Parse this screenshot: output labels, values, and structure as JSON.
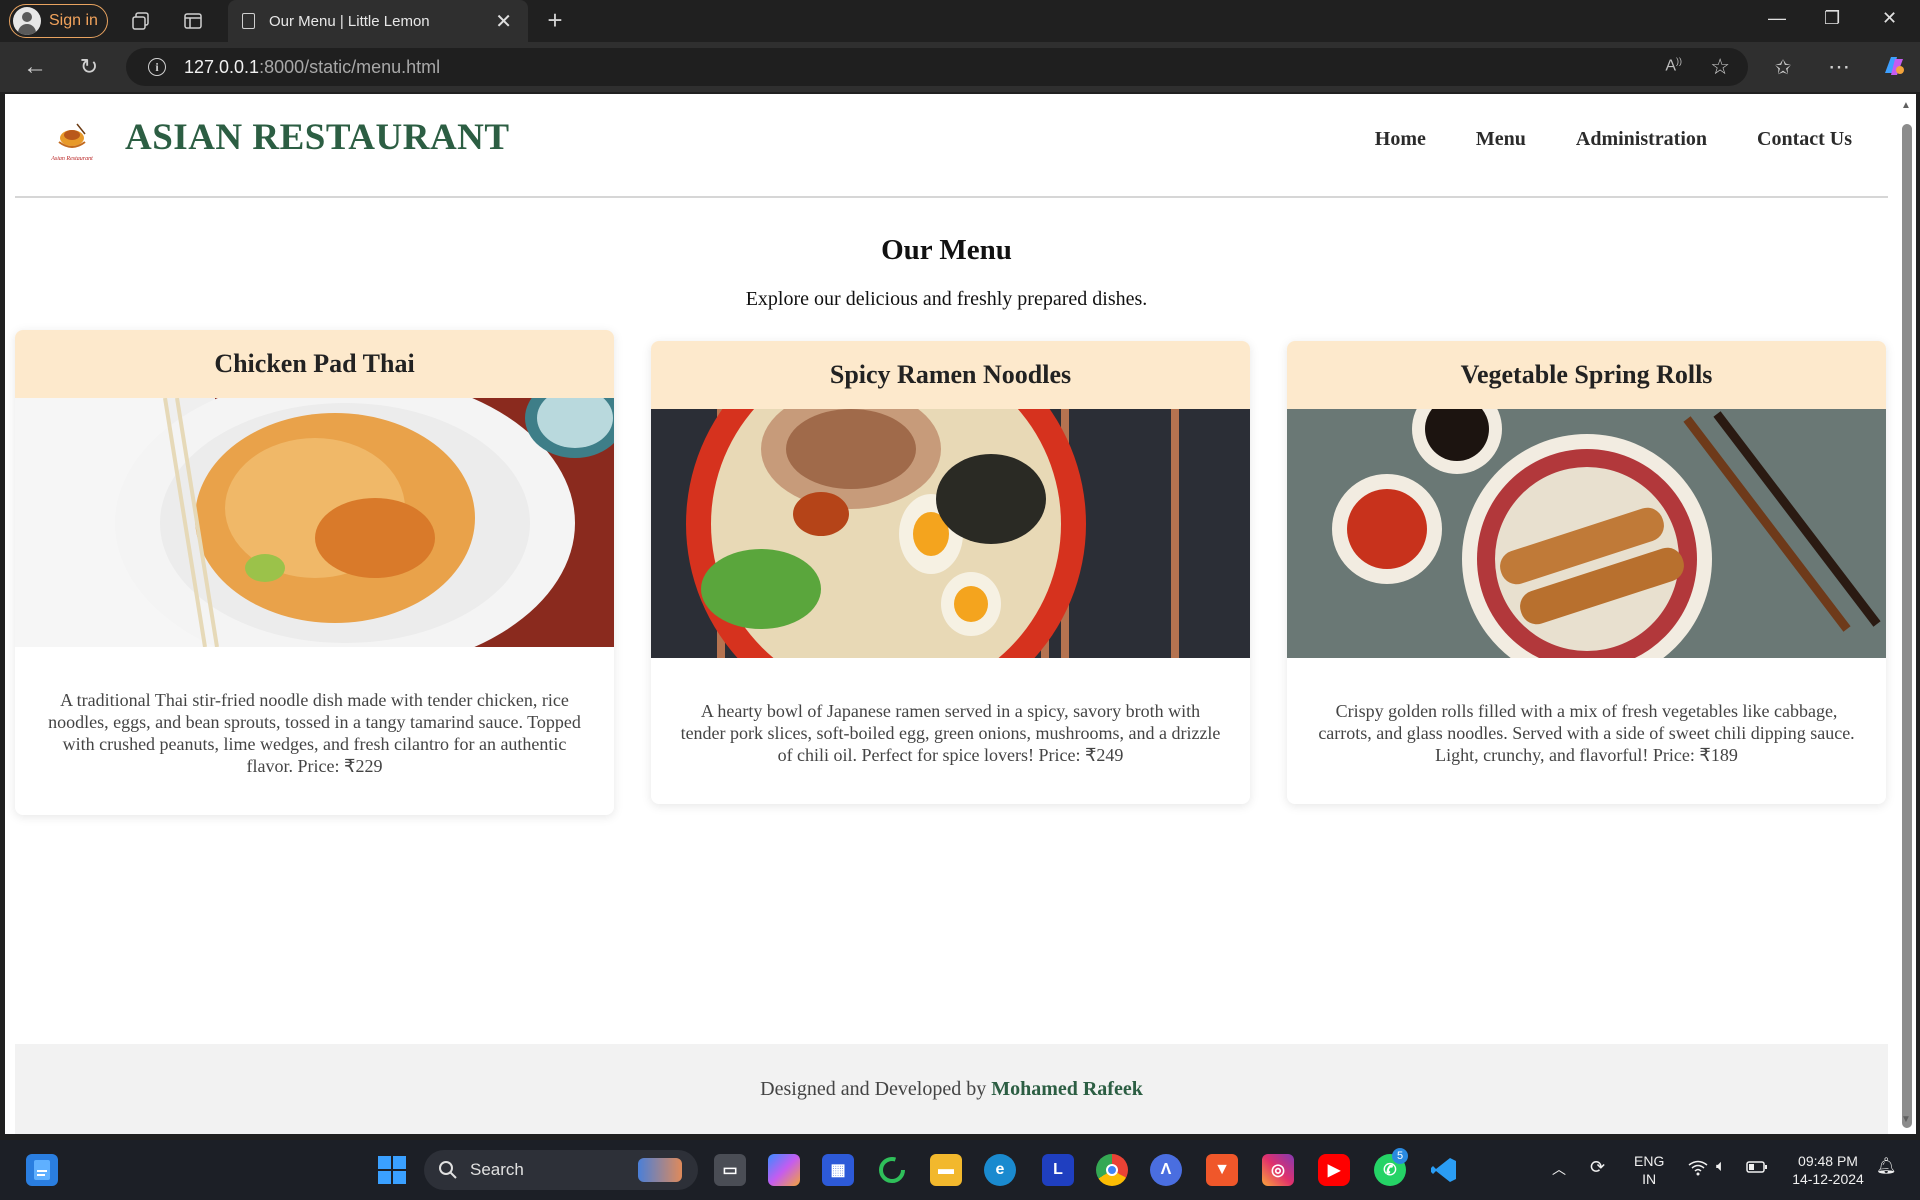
{
  "browser": {
    "sign_in_label": "Sign in",
    "tab_title": "Our Menu | Little Lemon",
    "url_host": "127.0.0.1",
    "url_rest": ":8000/static/menu.html"
  },
  "site": {
    "brand": "ASIAN RESTAURANT",
    "logo_text": "Asian Restaurant",
    "nav": [
      "Home",
      "Menu",
      "Administration",
      "Contact Us"
    ]
  },
  "menu": {
    "title": "Our Menu",
    "subtitle": "Explore our delicious and freshly prepared dishes.",
    "items": [
      {
        "name": "Chicken Pad Thai",
        "description": "A traditional Thai stir-fried noodle dish made with tender chicken, rice noodles, eggs, and bean sprouts, tossed in a tangy tamarind sauce. Topped with crushed peanuts, lime wedges, and fresh cilantro for an authentic flavor. Price: ₹229"
      },
      {
        "name": "Spicy Ramen Noodles",
        "description": "A hearty bowl of Japanese ramen served in a spicy, savory broth with tender pork slices, soft-boiled egg, green onions, mushrooms, and a drizzle of chili oil. Perfect for spice lovers! Price: ₹249"
      },
      {
        "name": "Vegetable Spring Rolls",
        "description": "Crispy golden rolls filled with a mix of fresh vegetables like cabbage, carrots, and glass noodles. Served with a side of sweet chili dipping sauce. Light, crunchy, and flavorful! Price: ₹189"
      }
    ]
  },
  "footer": {
    "text": "Designed and Developed by",
    "author": "Mohamed Rafeek"
  },
  "taskbar": {
    "search_label": "Search",
    "lang_top": "ENG",
    "lang_bottom": "IN",
    "time": "09:48 PM",
    "date": "14-12-2024",
    "whatsapp_badge": "5"
  },
  "colors": {
    "brand_green": "#2c5e43",
    "card_header": "#fde9cc",
    "signin_orange": "#f2a35c"
  }
}
